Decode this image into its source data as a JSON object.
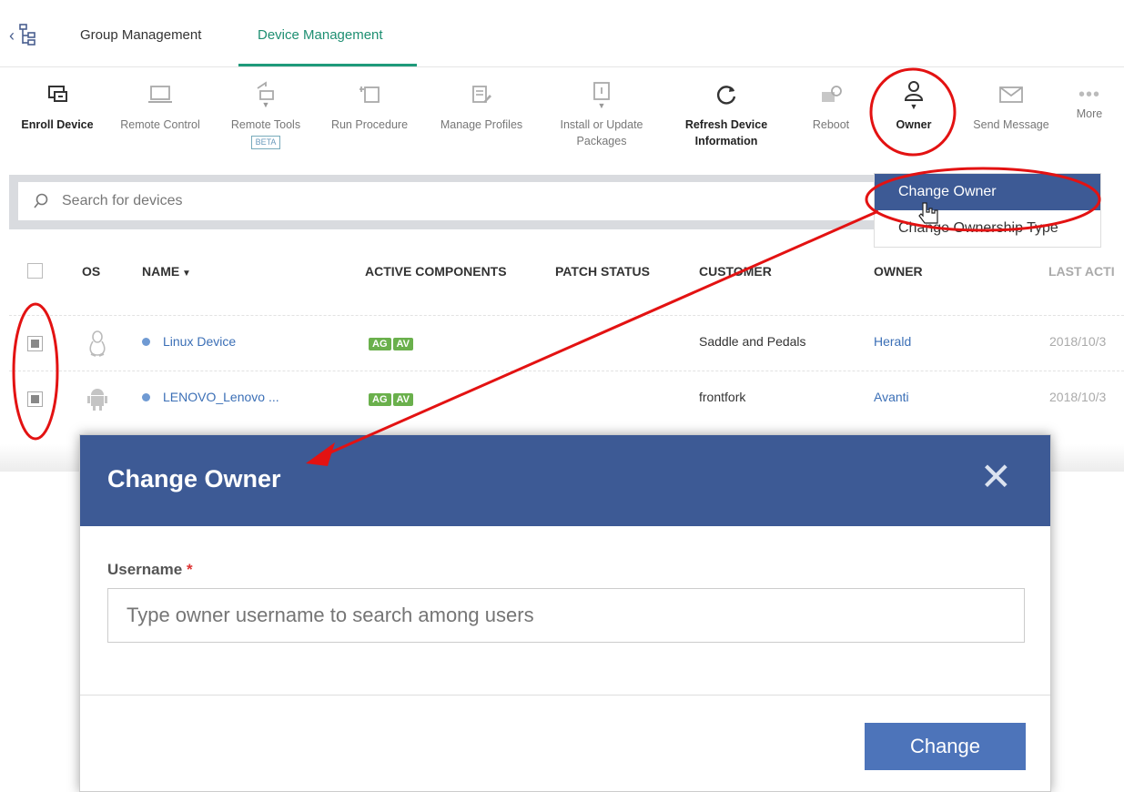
{
  "tabs": [
    {
      "label": "Group Management"
    },
    {
      "label": "Device Management",
      "active": true
    }
  ],
  "toolbar": {
    "enroll": "Enroll Device",
    "remote_control": "Remote Control",
    "remote_tools": "Remote Tools",
    "beta": "BETA",
    "run_procedure": "Run Procedure",
    "manage_profiles": "Manage Profiles",
    "install_1": "Install or Update",
    "install_2": "Packages",
    "refresh_1": "Refresh Device",
    "refresh_2": "Information",
    "reboot": "Reboot",
    "owner": "Owner",
    "send_message": "Send Message",
    "more": "More"
  },
  "search": {
    "placeholder": "Search for devices"
  },
  "owner_menu": {
    "change_owner": "Change Owner",
    "change_ownership_type": "Change Ownership Type"
  },
  "table": {
    "headers": {
      "os": "OS",
      "name": "NAME",
      "active_components": "ACTIVE COMPONENTS",
      "patch_status": "PATCH STATUS",
      "customer": "CUSTOMER",
      "owner": "OWNER",
      "last_active": "LAST ACTI"
    },
    "rows": [
      {
        "name": "Linux Device",
        "badges": [
          "AG",
          "AV"
        ],
        "customer": "Saddle and Pedals",
        "owner": "Herald",
        "last_active": "2018/10/3"
      },
      {
        "name": "LENOVO_Lenovo ...",
        "badges": [
          "AG",
          "AV"
        ],
        "customer": "frontfork",
        "owner": "Avanti",
        "last_active": "2018/10/3"
      }
    ]
  },
  "modal": {
    "title": "Change Owner",
    "close": "✕",
    "username_label": "Username",
    "required_mark": "*",
    "username_placeholder": "Type owner username to search among users",
    "change_button": "Change"
  },
  "colors": {
    "header_blue": "#3d5a95",
    "button_blue": "#4d74ba",
    "tab_green": "#1f9a7a",
    "badge_green": "#6ab04c",
    "annotation_red": "#e31212"
  }
}
